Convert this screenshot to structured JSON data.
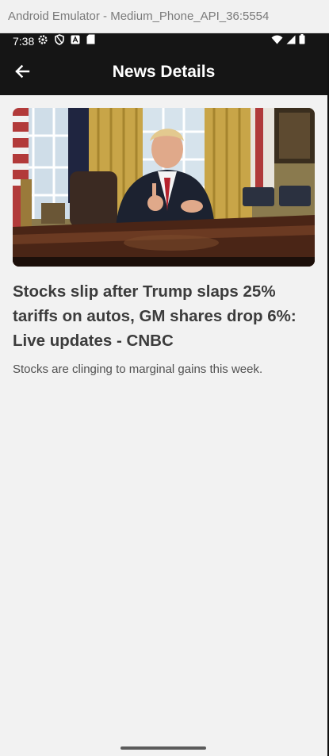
{
  "window": {
    "title": "Android Emulator - Medium_Phone_API_36:5554"
  },
  "status_bar": {
    "time": "7:38",
    "left_icons": [
      "settings-icon",
      "shield-icon",
      "font-icon",
      "sd-card-icon"
    ],
    "right_icons": [
      "wifi-icon",
      "signal-icon",
      "battery-icon"
    ]
  },
  "app_bar": {
    "title": "News Details",
    "back_icon": "arrow-left-icon"
  },
  "article": {
    "headline": "Stocks slip after Trump slaps 25% tariffs on autos, GM shares drop 6%: Live updates - CNBC",
    "summary": "Stocks are clinging to marginal gains this week.",
    "image_subject": "photo"
  },
  "colors": {
    "app_bar": "#151515",
    "background": "#f2f2f2",
    "headline": "#3c3c3c",
    "summary": "#505050"
  }
}
